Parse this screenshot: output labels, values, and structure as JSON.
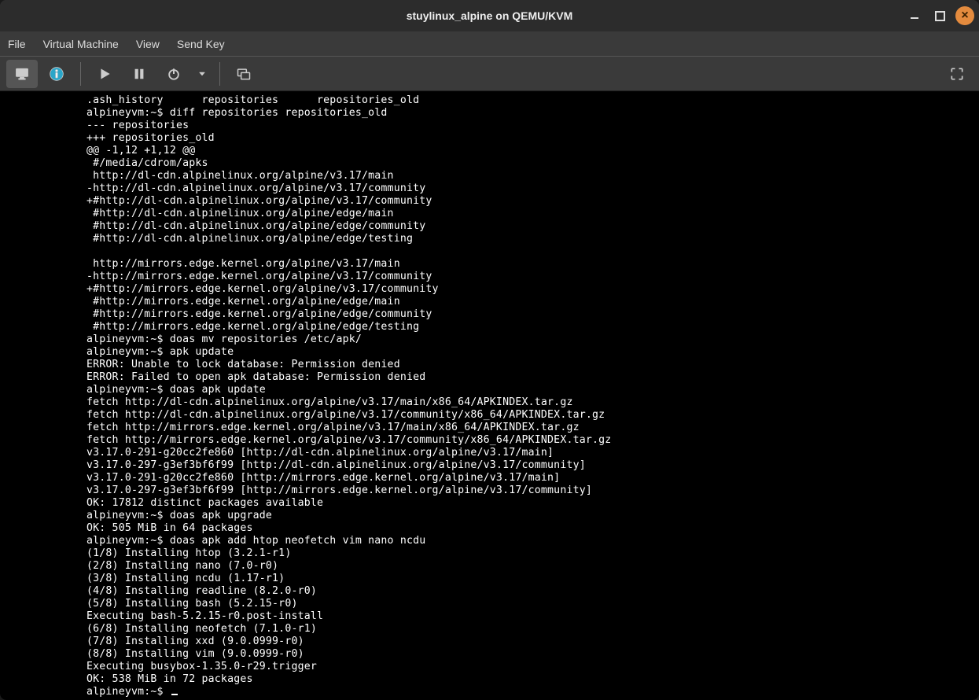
{
  "window": {
    "title": "stuylinux_alpine on QEMU/KVM"
  },
  "menu": {
    "file": "File",
    "vm": "Virtual Machine",
    "view": "View",
    "sendkey": "Send Key"
  },
  "toolbar": {
    "console": "console-icon",
    "info": "info-icon",
    "play": "play-icon",
    "pause": "pause-icon",
    "power": "power-icon",
    "dropdown": "chevron-down-icon",
    "snapshot": "snapshot-icon",
    "fullscreen": "fullscreen-icon"
  },
  "prompt": "alpineyvm:~$ ",
  "terminal": {
    "lines": [
      ".ash_history      repositories      repositories_old",
      "alpineyvm:~$ diff repositories repositories_old",
      "--- repositories",
      "+++ repositories_old",
      "@@ -1,12 +1,12 @@",
      " #/media/cdrom/apks",
      " http://dl-cdn.alpinelinux.org/alpine/v3.17/main",
      "-http://dl-cdn.alpinelinux.org/alpine/v3.17/community",
      "+#http://dl-cdn.alpinelinux.org/alpine/v3.17/community",
      " #http://dl-cdn.alpinelinux.org/alpine/edge/main",
      " #http://dl-cdn.alpinelinux.org/alpine/edge/community",
      " #http://dl-cdn.alpinelinux.org/alpine/edge/testing",
      "",
      " http://mirrors.edge.kernel.org/alpine/v3.17/main",
      "-http://mirrors.edge.kernel.org/alpine/v3.17/community",
      "+#http://mirrors.edge.kernel.org/alpine/v3.17/community",
      " #http://mirrors.edge.kernel.org/alpine/edge/main",
      " #http://mirrors.edge.kernel.org/alpine/edge/community",
      " #http://mirrors.edge.kernel.org/alpine/edge/testing",
      "alpineyvm:~$ doas mv repositories /etc/apk/",
      "alpineyvm:~$ apk update",
      "ERROR: Unable to lock database: Permission denied",
      "ERROR: Failed to open apk database: Permission denied",
      "alpineyvm:~$ doas apk update",
      "fetch http://dl-cdn.alpinelinux.org/alpine/v3.17/main/x86_64/APKINDEX.tar.gz",
      "fetch http://dl-cdn.alpinelinux.org/alpine/v3.17/community/x86_64/APKINDEX.tar.gz",
      "fetch http://mirrors.edge.kernel.org/alpine/v3.17/main/x86_64/APKINDEX.tar.gz",
      "fetch http://mirrors.edge.kernel.org/alpine/v3.17/community/x86_64/APKINDEX.tar.gz",
      "v3.17.0-291-g20cc2fe860 [http://dl-cdn.alpinelinux.org/alpine/v3.17/main]",
      "v3.17.0-297-g3ef3bf6f99 [http://dl-cdn.alpinelinux.org/alpine/v3.17/community]",
      "v3.17.0-291-g20cc2fe860 [http://mirrors.edge.kernel.org/alpine/v3.17/main]",
      "v3.17.0-297-g3ef3bf6f99 [http://mirrors.edge.kernel.org/alpine/v3.17/community]",
      "OK: 17812 distinct packages available",
      "alpineyvm:~$ doas apk upgrade",
      "OK: 505 MiB in 64 packages",
      "alpineyvm:~$ doas apk add htop neofetch vim nano ncdu",
      "(1/8) Installing htop (3.2.1-r1)",
      "(2/8) Installing nano (7.0-r0)",
      "(3/8) Installing ncdu (1.17-r1)",
      "(4/8) Installing readline (8.2.0-r0)",
      "(5/8) Installing bash (5.2.15-r0)",
      "Executing bash-5.2.15-r0.post-install",
      "(6/8) Installing neofetch (7.1.0-r1)",
      "(7/8) Installing xxd (9.0.0999-r0)",
      "(8/8) Installing vim (9.0.0999-r0)",
      "Executing busybox-1.35.0-r29.trigger",
      "OK: 538 MiB in 72 packages"
    ]
  }
}
